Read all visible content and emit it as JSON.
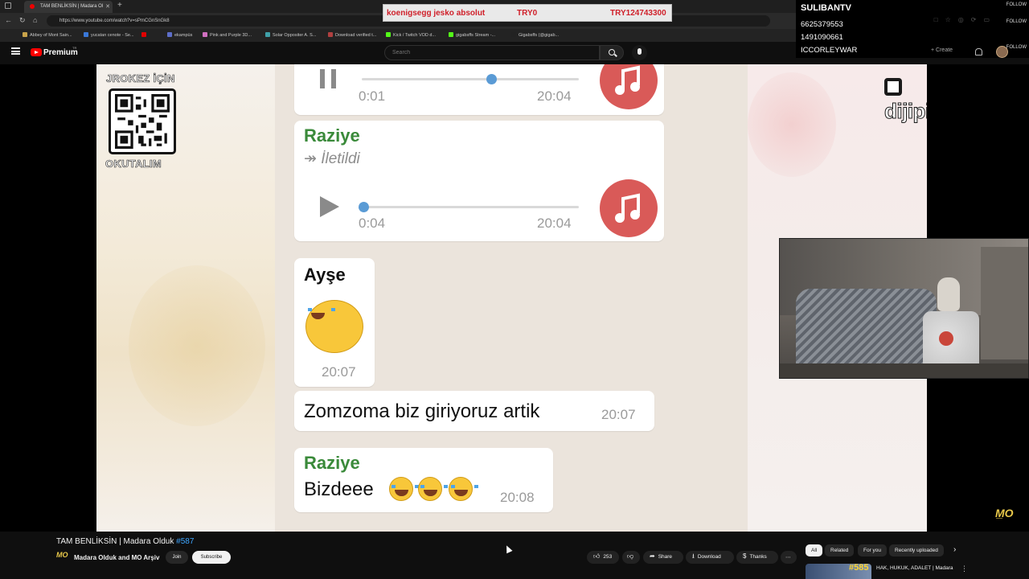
{
  "browser": {
    "tab_title": "TAM BENLİKSİN | Madara Ol",
    "url": "https://www.youtube.com/watch?v=sPmCGnSnGk8",
    "bookmarks": [
      {
        "label": "Abbey of Mont Sain...",
        "color": "#c8a34a"
      },
      {
        "label": "yucatan cenote - Se...",
        "color": "#3a78d8"
      },
      {
        "label": "",
        "color": "#e00000"
      },
      {
        "label": "ekampüs",
        "color": "#5d6ec9"
      },
      {
        "label": "Pink and Purple 3D...",
        "color": "#d070c0"
      },
      {
        "label": "Solar Oppositer A. S...",
        "color": "#3fa0a8"
      },
      {
        "label": "Download verified t...",
        "color": "#b04040"
      },
      {
        "label": "Kick / Twitch VOD d...",
        "color": "#53fc18"
      },
      {
        "label": "gigabsffs Stream -...",
        "color": "#53fc18"
      },
      {
        "label": "Gigabsffs (@gigab...",
        "color": "#222222"
      }
    ]
  },
  "stream_overlay": {
    "ticker": {
      "item": "koenigsegg jesko absolut",
      "price": "TRY0",
      "total": "TRY124743300"
    },
    "right_panel": {
      "name": "SULIBANTV",
      "line1": "6625379553",
      "line2": "1491090661",
      "line3": "ICCORLEYWAR",
      "follow": "FOLLOW"
    },
    "qr_top": "JROKEZ İÇİN",
    "qr_bottom": "OKUTALIM",
    "sponsor_logo": "dijipin",
    "watermark": "M̲O"
  },
  "youtube": {
    "brand": "Premium",
    "region": "TR",
    "search_placeholder": "Search",
    "create_label": "Create"
  },
  "chat": {
    "voice1": {
      "elapsed": "0:01",
      "sent": "20:04",
      "progress": 0.6
    },
    "forward": {
      "sender": "Raziye",
      "label": "İletildi"
    },
    "voice2": {
      "elapsed": "0:04",
      "sent": "20:04",
      "progress": 0.02
    },
    "emoji_msg": {
      "sender": "Ayşe",
      "time": "20:07"
    },
    "text_msg": {
      "text": "Zomzoma biz giriyoruz artik",
      "time": "20:07"
    },
    "last_msg": {
      "sender": "Raziye",
      "text": "Bizdeee",
      "time": "20:08"
    }
  },
  "video": {
    "title": "TAM BENLİKSİN | Madara Olduk",
    "episode_tag": "#587",
    "channel": "Madara Olduk and MO Arşiv",
    "channel_mark": "MO",
    "join_label": "Join",
    "subscribe_label": "Subscribe",
    "like_count": "253",
    "share_label": "Share",
    "download_label": "Download",
    "thanks_label": "Thanks"
  },
  "sidebar": {
    "chips": [
      "All",
      "Related",
      "For you",
      "Recently uploaded"
    ],
    "recommendation": {
      "badge": "#585",
      "title": "HAK, HUKUK, ADALET | Madara"
    }
  }
}
